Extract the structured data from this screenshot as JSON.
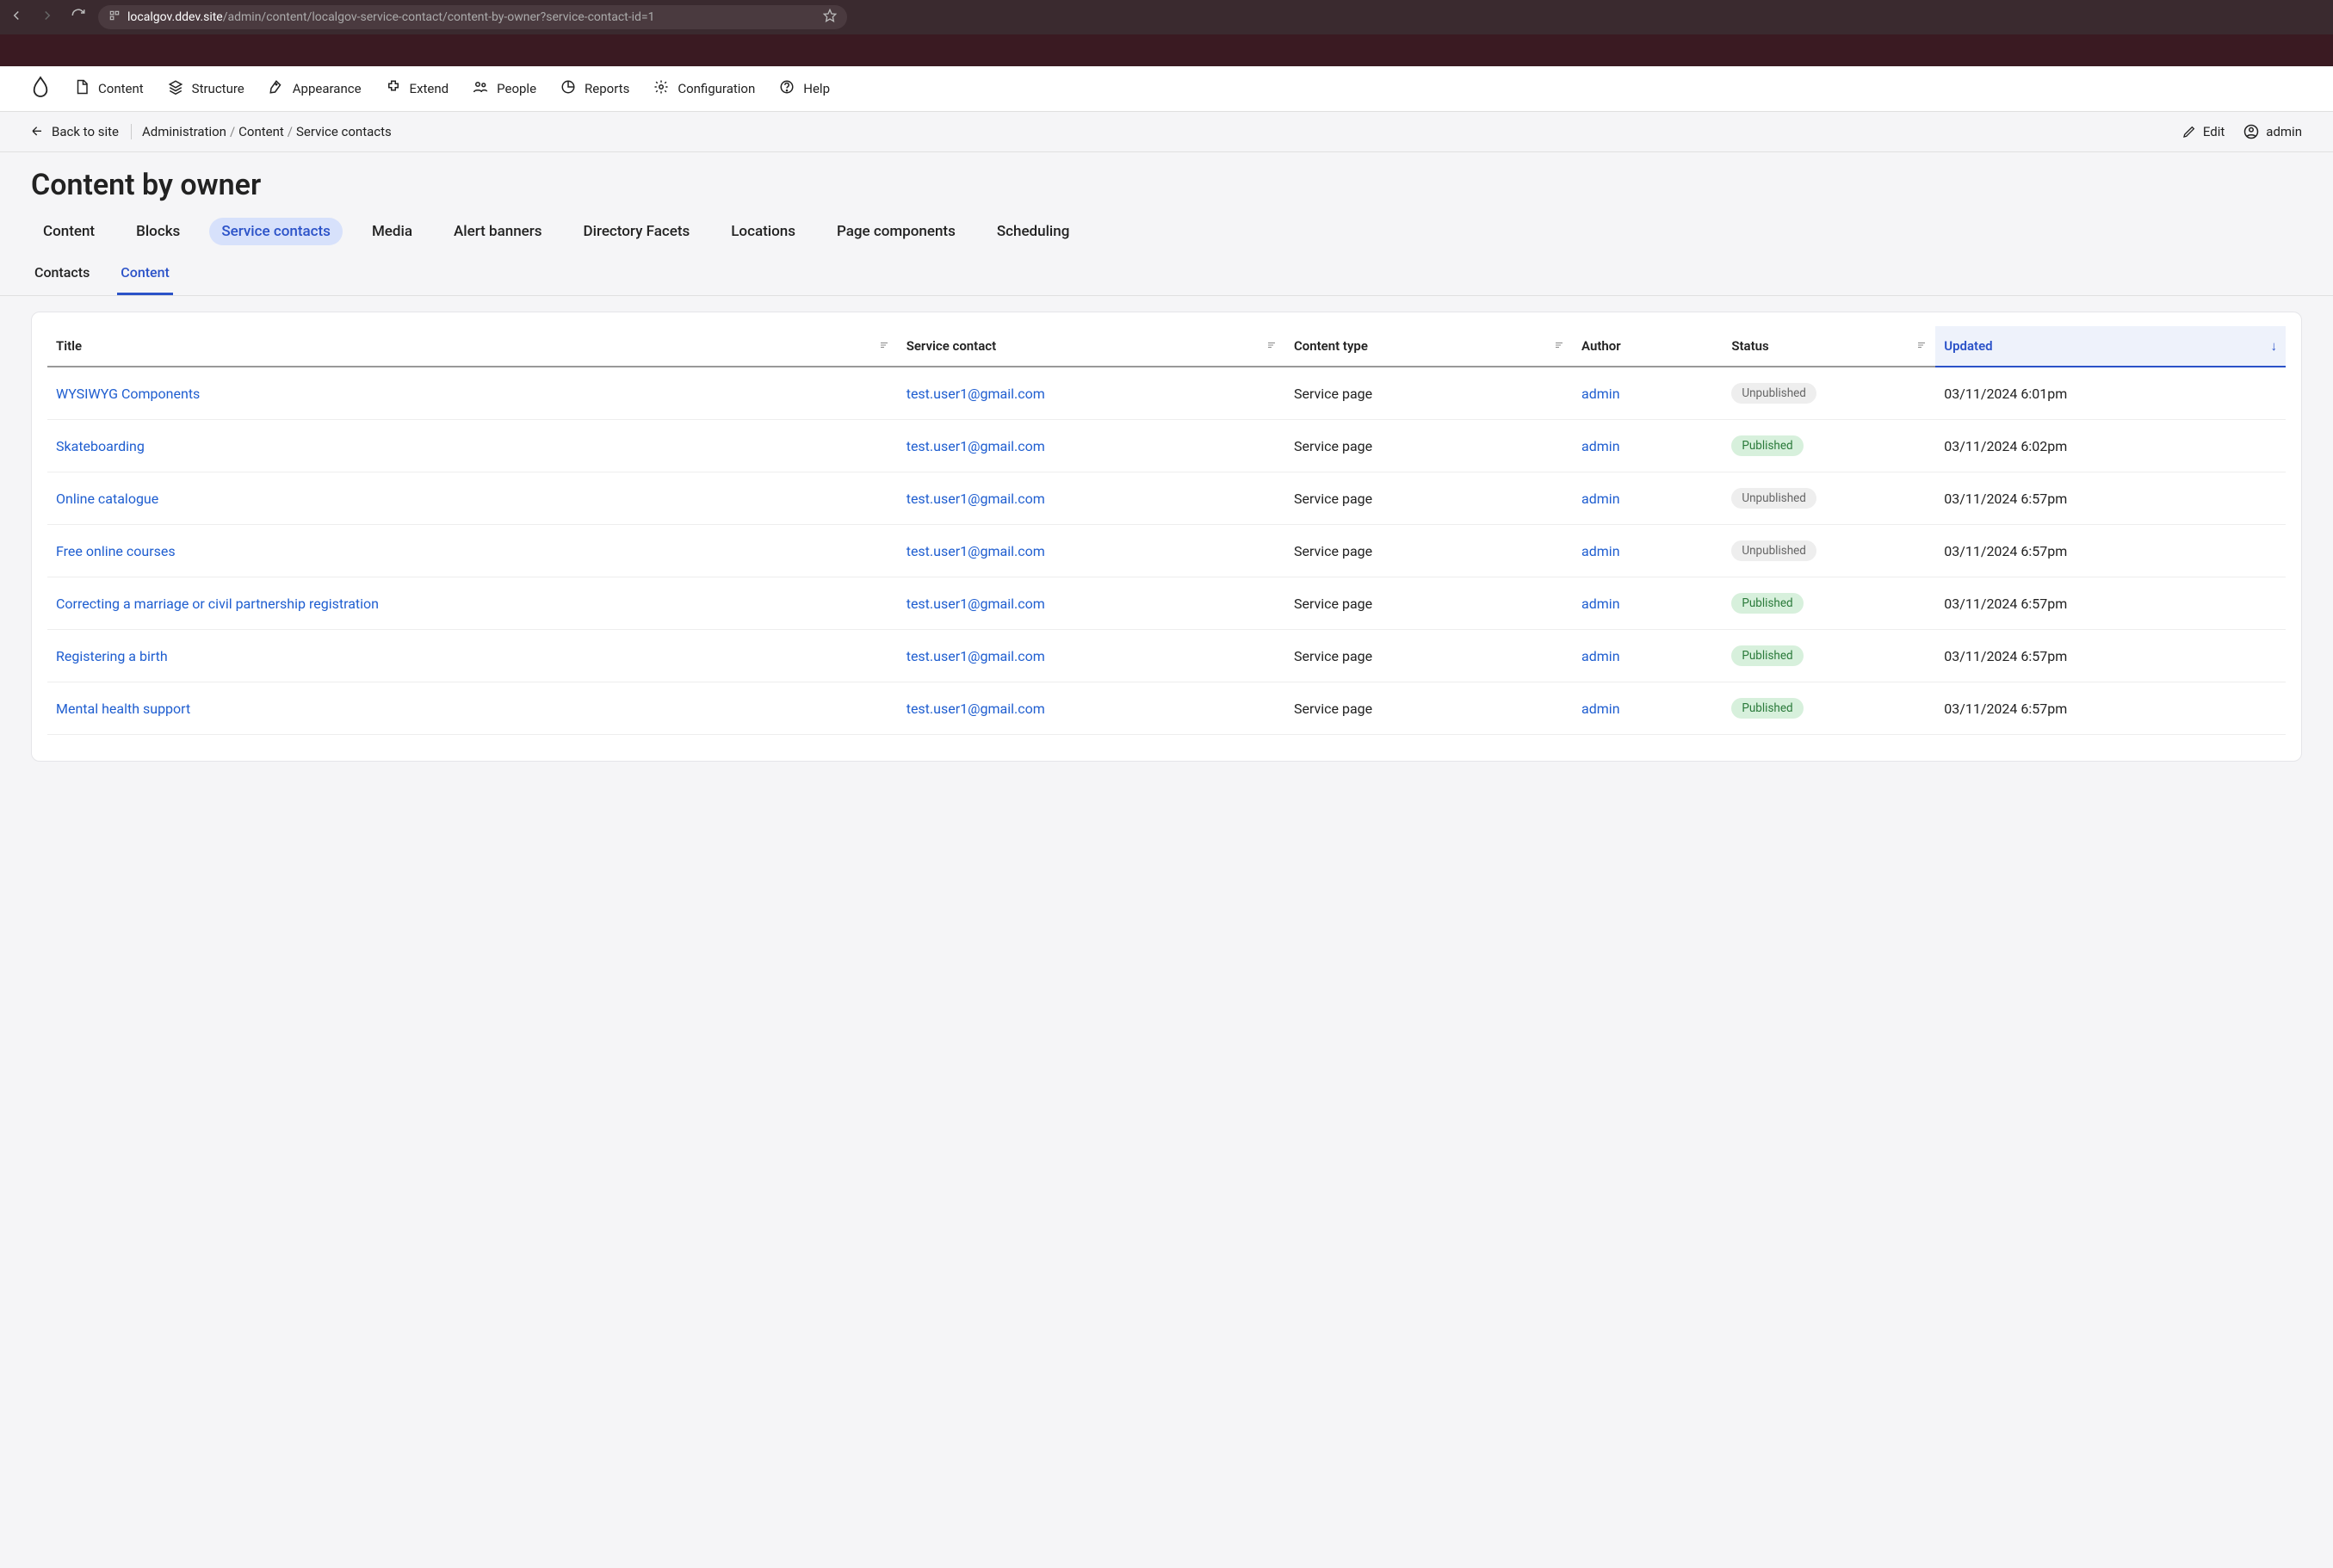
{
  "browser": {
    "url_host": "localgov.ddev.site",
    "url_path": "/admin/content/localgov-service-contact/content-by-owner?service-contact-id=1"
  },
  "toolbar": {
    "items": [
      {
        "label": "Content",
        "icon": "file"
      },
      {
        "label": "Structure",
        "icon": "layers"
      },
      {
        "label": "Appearance",
        "icon": "pen"
      },
      {
        "label": "Extend",
        "icon": "plugin"
      },
      {
        "label": "People",
        "icon": "people"
      },
      {
        "label": "Reports",
        "icon": "chart"
      },
      {
        "label": "Configuration",
        "icon": "gear"
      },
      {
        "label": "Help",
        "icon": "help"
      }
    ]
  },
  "breadcrumbs": {
    "back": "Back to site",
    "items": [
      "Administration",
      "Content",
      "Service contacts"
    ],
    "edit": "Edit",
    "user": "admin"
  },
  "page": {
    "title": "Content by owner"
  },
  "primary_tabs": [
    "Content",
    "Blocks",
    "Service contacts",
    "Media",
    "Alert banners",
    "Directory Facets",
    "Locations",
    "Page components",
    "Scheduling"
  ],
  "primary_tabs_active": 2,
  "secondary_tabs": [
    "Contacts",
    "Content"
  ],
  "secondary_tabs_active": 1,
  "table": {
    "columns": [
      "Title",
      "Service contact",
      "Content type",
      "Author",
      "Status",
      "Updated"
    ],
    "sorted_col": 5,
    "rows": [
      {
        "title": "WYSIWYG Components",
        "contact": "test.user1@gmail.com",
        "type": "Service page",
        "author": "admin",
        "status": "Unpublished",
        "updated": "03/11/2024 6:01pm"
      },
      {
        "title": "Skateboarding",
        "contact": "test.user1@gmail.com",
        "type": "Service page",
        "author": "admin",
        "status": "Published",
        "updated": "03/11/2024 6:02pm"
      },
      {
        "title": "Online catalogue",
        "contact": "test.user1@gmail.com",
        "type": "Service page",
        "author": "admin",
        "status": "Unpublished",
        "updated": "03/11/2024 6:57pm"
      },
      {
        "title": "Free online courses",
        "contact": "test.user1@gmail.com",
        "type": "Service page",
        "author": "admin",
        "status": "Unpublished",
        "updated": "03/11/2024 6:57pm"
      },
      {
        "title": "Correcting a marriage or civil partnership registration",
        "contact": "test.user1@gmail.com",
        "type": "Service page",
        "author": "admin",
        "status": "Published",
        "updated": "03/11/2024 6:57pm"
      },
      {
        "title": "Registering a birth",
        "contact": "test.user1@gmail.com",
        "type": "Service page",
        "author": "admin",
        "status": "Published",
        "updated": "03/11/2024 6:57pm"
      },
      {
        "title": "Mental health support",
        "contact": "test.user1@gmail.com",
        "type": "Service page",
        "author": "admin",
        "status": "Published",
        "updated": "03/11/2024 6:57pm"
      }
    ]
  }
}
